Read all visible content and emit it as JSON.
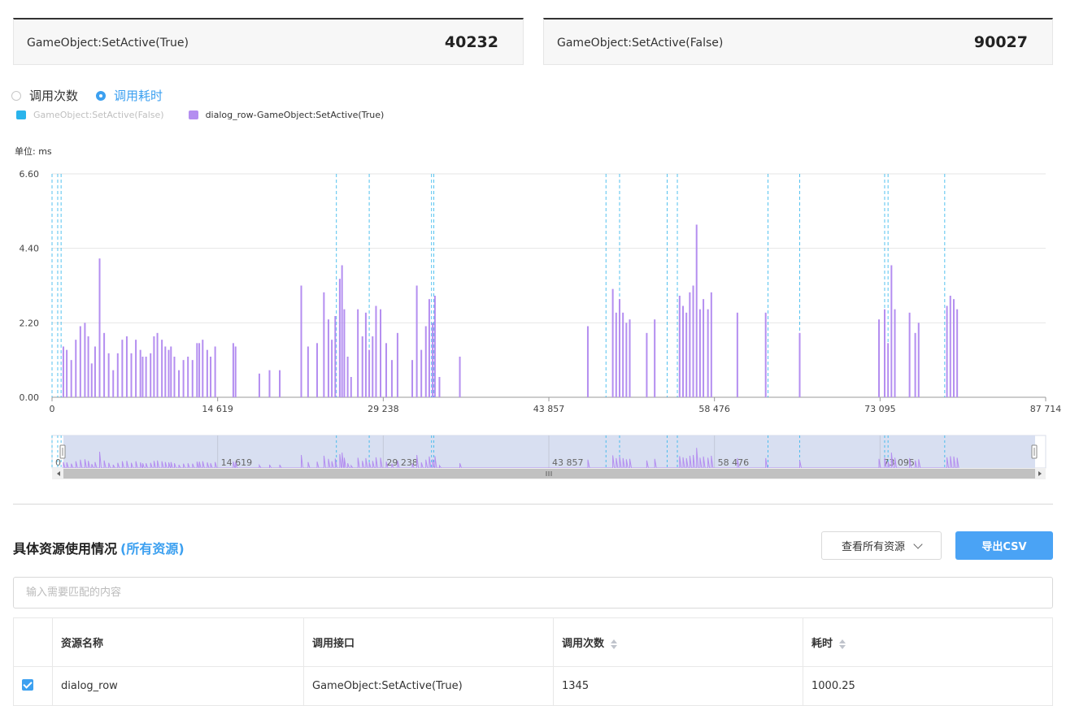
{
  "summary": {
    "true_label": "GameObject:SetActive(True)",
    "true_value": "40232",
    "false_label": "GameObject:SetActive(False)",
    "false_value": "90027"
  },
  "mode": {
    "count_label": "调用次数",
    "time_label": "调用耗时",
    "selected": "time"
  },
  "legend": {
    "false_series": "GameObject:SetActive(False)",
    "true_series": "dialog_row-GameObject:SetActive(True)"
  },
  "unit_label": "单位: ms",
  "colors": {
    "false_series": "#2ab4ec",
    "true_series": "#b48ef0",
    "accent": "#3ca0f0"
  },
  "chart_data": {
    "type": "bar",
    "xlabel": "",
    "ylabel": "",
    "ylim": [
      0,
      6.6
    ],
    "xlim": [
      0,
      87714
    ],
    "y_ticks": [
      "0.00",
      "2.20",
      "4.40",
      "6.60"
    ],
    "x_ticks": [
      "0",
      "14 619",
      "29 238",
      "43 857",
      "58 476",
      "73 095",
      "87 714"
    ],
    "series": [
      {
        "name": "dialog_row-GameObject:SetActive(True)",
        "legend_state": "visible",
        "points": [
          [
            1000,
            1.5
          ],
          [
            1300,
            1.4
          ],
          [
            1700,
            1.1
          ],
          [
            2100,
            1.7
          ],
          [
            2500,
            2.1
          ],
          [
            2900,
            2.2
          ],
          [
            3200,
            1.8
          ],
          [
            3500,
            1.0
          ],
          [
            3800,
            1.5
          ],
          [
            4200,
            4.1
          ],
          [
            4600,
            1.9
          ],
          [
            5000,
            1.3
          ],
          [
            5400,
            0.8
          ],
          [
            5800,
            1.3
          ],
          [
            6200,
            1.7
          ],
          [
            6600,
            1.8
          ],
          [
            7000,
            1.3
          ],
          [
            7400,
            1.7
          ],
          [
            7800,
            1.4
          ],
          [
            8000,
            1.2
          ],
          [
            8300,
            1.2
          ],
          [
            8700,
            1.3
          ],
          [
            9000,
            1.8
          ],
          [
            9300,
            1.9
          ],
          [
            9700,
            1.7
          ],
          [
            10000,
            1.5
          ],
          [
            10300,
            1.4
          ],
          [
            10500,
            1.5
          ],
          [
            10800,
            1.2
          ],
          [
            11200,
            0.8
          ],
          [
            11600,
            1.1
          ],
          [
            12000,
            1.2
          ],
          [
            12400,
            1.1
          ],
          [
            12800,
            1.6
          ],
          [
            13000,
            1.6
          ],
          [
            13300,
            1.7
          ],
          [
            13700,
            1.4
          ],
          [
            14000,
            1.2
          ],
          [
            14400,
            1.5
          ],
          [
            16000,
            1.6
          ],
          [
            16200,
            1.5
          ],
          [
            18300,
            0.7
          ],
          [
            19200,
            0.8
          ],
          [
            20100,
            0.8
          ],
          [
            22000,
            3.3
          ],
          [
            22600,
            1.5
          ],
          [
            23400,
            1.6
          ],
          [
            24000,
            3.1
          ],
          [
            24400,
            2.3
          ],
          [
            24700,
            1.7
          ],
          [
            25000,
            2.4
          ],
          [
            25400,
            3.5
          ],
          [
            25600,
            3.9
          ],
          [
            25800,
            2.6
          ],
          [
            26100,
            1.2
          ],
          [
            26400,
            0.6
          ],
          [
            27000,
            2.6
          ],
          [
            27400,
            1.8
          ],
          [
            27700,
            2.5
          ],
          [
            28000,
            1.4
          ],
          [
            28300,
            1.8
          ],
          [
            28600,
            2.7
          ],
          [
            29000,
            2.6
          ],
          [
            29500,
            1.6
          ],
          [
            30000,
            1.1
          ],
          [
            30500,
            1.9
          ],
          [
            31800,
            1.1
          ],
          [
            32200,
            3.3
          ],
          [
            32600,
            1.4
          ],
          [
            33000,
            2.1
          ],
          [
            33300,
            2.9
          ],
          [
            33600,
            2.2
          ],
          [
            33800,
            3.0
          ],
          [
            34200,
            0.6
          ],
          [
            36000,
            1.2
          ],
          [
            47300,
            2.1
          ],
          [
            49500,
            3.2
          ],
          [
            49800,
            2.5
          ],
          [
            50100,
            2.9
          ],
          [
            50400,
            2.5
          ],
          [
            50700,
            2.2
          ],
          [
            51000,
            2.3
          ],
          [
            52500,
            1.9
          ],
          [
            53200,
            2.3
          ],
          [
            55400,
            3.0
          ],
          [
            55700,
            2.7
          ],
          [
            56000,
            2.5
          ],
          [
            56300,
            3.1
          ],
          [
            56600,
            3.3
          ],
          [
            56900,
            5.1
          ],
          [
            57200,
            2.6
          ],
          [
            57500,
            2.9
          ],
          [
            57900,
            2.6
          ],
          [
            58200,
            3.1
          ],
          [
            60500,
            2.5
          ],
          [
            63000,
            2.5
          ],
          [
            66000,
            1.9
          ],
          [
            73000,
            2.3
          ],
          [
            73500,
            2.6
          ],
          [
            73800,
            1.6
          ],
          [
            74100,
            3.9
          ],
          [
            74400,
            2.6
          ],
          [
            75700,
            2.5
          ],
          [
            76200,
            1.9
          ],
          [
            76500,
            2.2
          ],
          [
            79000,
            2.7
          ],
          [
            79300,
            3.0
          ],
          [
            79600,
            2.9
          ],
          [
            79900,
            2.6
          ]
        ]
      },
      {
        "name": "GameObject:SetActive(False)",
        "legend_state": "hidden",
        "markers_x": [
          0,
          500,
          800,
          25100,
          28000,
          33500,
          33700,
          48900,
          50100,
          54300,
          55200,
          63200,
          66000,
          73500,
          73800,
          78800
        ]
      }
    ],
    "zoom_range": [
      0,
      87714
    ]
  },
  "resources": {
    "title": "具体资源使用情况",
    "title_accent": "(所有资源)",
    "view_all_label": "查看所有资源",
    "export_label": "导出CSV",
    "search_placeholder": "输入需要匹配的内容",
    "columns": {
      "name": "资源名称",
      "api": "调用接口",
      "count": "调用次数",
      "time": "耗时"
    },
    "rows": [
      {
        "name": "dialog_row",
        "api": "GameObject:SetActive(True)",
        "count": "1345",
        "time": "1000.25",
        "checked": true
      }
    ]
  }
}
